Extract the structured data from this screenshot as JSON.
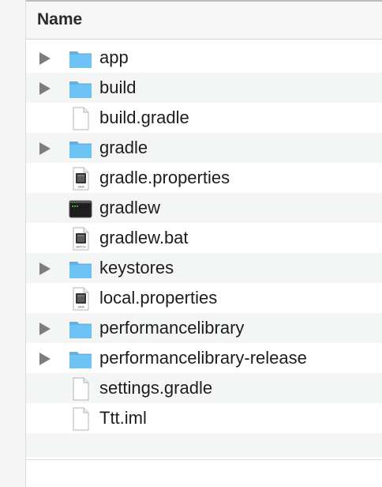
{
  "header": {
    "label": "Name"
  },
  "rows": [
    {
      "name": "app",
      "kind": "folder",
      "expandable": true
    },
    {
      "name": "build",
      "kind": "folder",
      "expandable": true
    },
    {
      "name": "build.gradle",
      "kind": "document",
      "expandable": false
    },
    {
      "name": "gradle",
      "kind": "folder",
      "expandable": true
    },
    {
      "name": "gradle.properties",
      "kind": "java-file",
      "badge": "JAVA",
      "expandable": false
    },
    {
      "name": "gradlew",
      "kind": "terminal-exec",
      "expandable": false
    },
    {
      "name": "gradlew.bat",
      "kind": "batch-file",
      "badge": "BATCH",
      "expandable": false
    },
    {
      "name": "keystores",
      "kind": "folder",
      "expandable": true
    },
    {
      "name": "local.properties",
      "kind": "java-file",
      "badge": "JAVA",
      "expandable": false
    },
    {
      "name": "performancelibrary",
      "kind": "folder",
      "expandable": true
    },
    {
      "name": "performancelibrary-release",
      "kind": "folder",
      "expandable": true
    },
    {
      "name": "settings.gradle",
      "kind": "document",
      "expandable": false
    },
    {
      "name": "Ttt.iml",
      "kind": "document",
      "expandable": false
    }
  ],
  "colors": {
    "folder": "#6cc3f4",
    "folder_tab": "#5bb3e8",
    "row_alt": "#f4f5f5",
    "disclosure": "#7d7d7d",
    "terminal_bg": "#1e1e1e",
    "terminal_text": "#4cd137"
  }
}
